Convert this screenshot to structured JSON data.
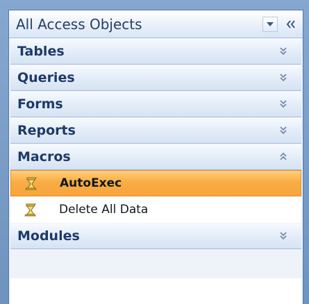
{
  "pane": {
    "title": "All Access Objects"
  },
  "groups": [
    {
      "label": "Tables",
      "state": "collapsed"
    },
    {
      "label": "Queries",
      "state": "collapsed"
    },
    {
      "label": "Forms",
      "state": "collapsed"
    },
    {
      "label": "Reports",
      "state": "collapsed"
    },
    {
      "label": "Macros",
      "state": "expanded"
    },
    {
      "label": "Modules",
      "state": "collapsed"
    }
  ],
  "macros": [
    {
      "label": "AutoExec",
      "selected": true,
      "icon": "macro-icon"
    },
    {
      "label": "Delete All Data",
      "selected": false,
      "icon": "macro-icon"
    }
  ],
  "colors": {
    "selection": "#f9ad45",
    "frame": "#6f93bf",
    "group_text": "#1d3a68"
  }
}
